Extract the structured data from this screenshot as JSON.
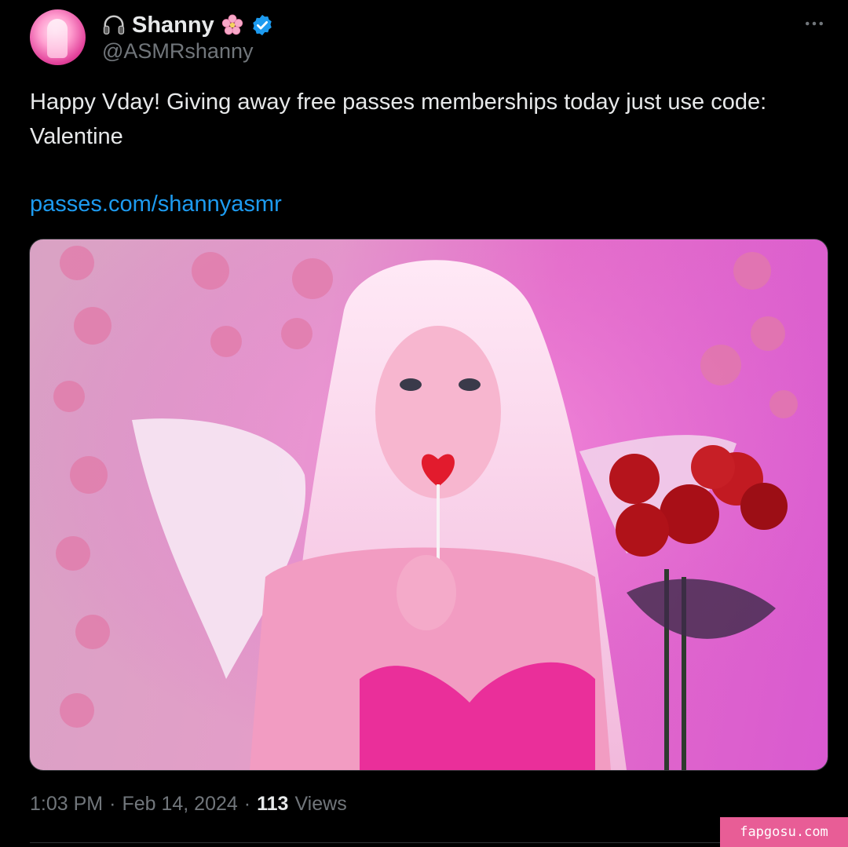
{
  "author": {
    "display_name": "Shanny",
    "handle": "@ASMRshanny",
    "verified": true,
    "icons": [
      "headphones-icon",
      "cherry-blossom-icon",
      "verified-badge-icon"
    ]
  },
  "tweet": {
    "text": "Happy Vday! Giving away free passes memberships today just use code: Valentine",
    "link": "passes.com/shannyasmr"
  },
  "meta": {
    "time": "1:03 PM",
    "separator": "·",
    "date": "Feb 14, 2024",
    "views_count": "113",
    "views_label": "Views"
  },
  "watermark": "fapgosu.com",
  "colors": {
    "background": "#000000",
    "text": "#e7e9ea",
    "muted": "#71767b",
    "link": "#1d9bf0",
    "verified": "#1d9bf0",
    "watermark_bg": "#e85d96"
  }
}
